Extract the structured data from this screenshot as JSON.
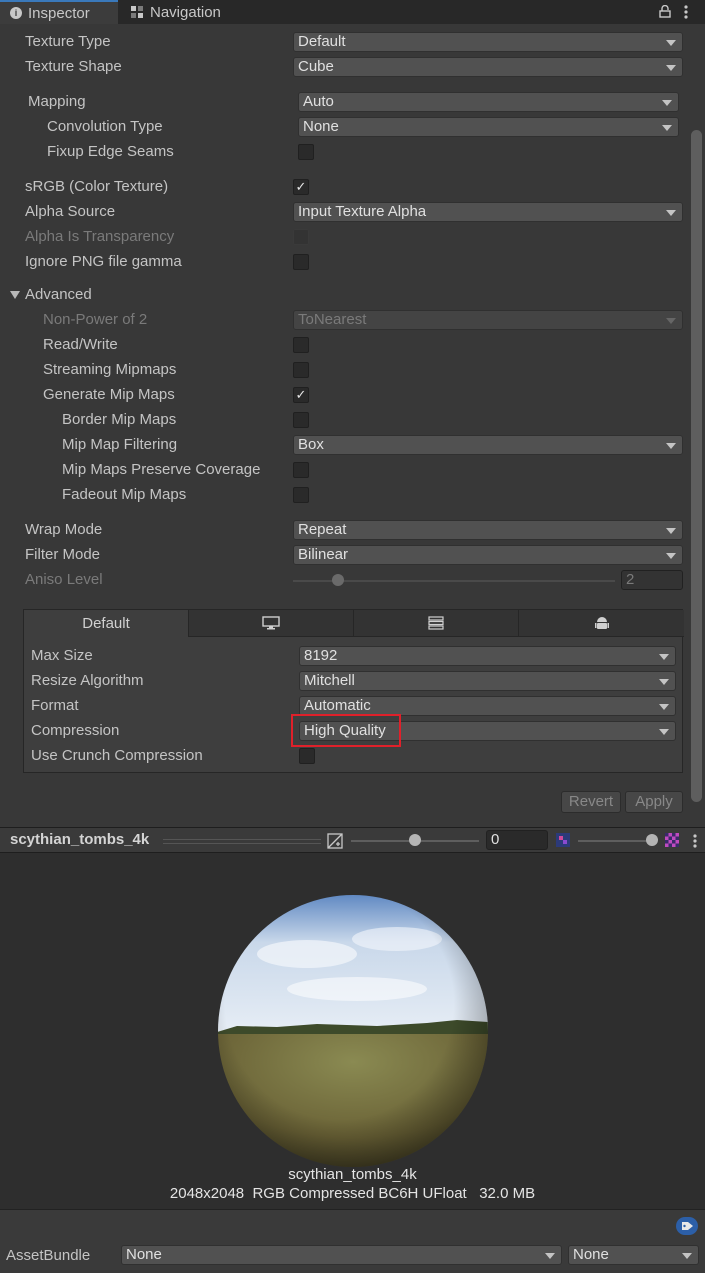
{
  "tabs": [
    {
      "label": "Inspector",
      "icon": "info-icon"
    },
    {
      "label": "Navigation",
      "icon": "navigation-icon"
    }
  ],
  "fields": {
    "texture_type": {
      "label": "Texture Type",
      "value": "Default"
    },
    "texture_shape": {
      "label": "Texture Shape",
      "value": "Cube"
    },
    "mapping": {
      "label": "Mapping",
      "value": "Auto"
    },
    "convolution_type": {
      "label": "Convolution Type",
      "value": "None"
    },
    "fixup_edge_seams": {
      "label": "Fixup Edge Seams",
      "checked": false
    },
    "srgb": {
      "label": "sRGB (Color Texture)",
      "checked": true
    },
    "alpha_source": {
      "label": "Alpha Source",
      "value": "Input Texture Alpha"
    },
    "alpha_is_transparency": {
      "label": "Alpha Is Transparency",
      "checked": false
    },
    "ignore_png_gamma": {
      "label": "Ignore PNG file gamma",
      "checked": false
    }
  },
  "advanced": {
    "label": "Advanced",
    "non_power_of_2": {
      "label": "Non-Power of 2",
      "value": "ToNearest"
    },
    "read_write": {
      "label": "Read/Write",
      "checked": false
    },
    "streaming_mipmaps": {
      "label": "Streaming Mipmaps",
      "checked": false
    },
    "generate_mip_maps": {
      "label": "Generate Mip Maps",
      "checked": true
    },
    "border_mip_maps": {
      "label": "Border Mip Maps",
      "checked": false
    },
    "mip_map_filtering": {
      "label": "Mip Map Filtering",
      "value": "Box"
    },
    "mip_maps_preserve_coverage": {
      "label": "Mip Maps Preserve Coverage",
      "checked": false
    },
    "fadeout_mip_maps": {
      "label": "Fadeout Mip Maps",
      "checked": false
    }
  },
  "wrap_mode": {
    "label": "Wrap Mode",
    "value": "Repeat"
  },
  "filter_mode": {
    "label": "Filter Mode",
    "value": "Bilinear"
  },
  "aniso_level": {
    "label": "Aniso Level",
    "value": "2"
  },
  "platform": {
    "tabs": [
      {
        "label": "Default"
      },
      {
        "icon": "monitor-icon"
      },
      {
        "icon": "server-icon"
      },
      {
        "icon": "android-icon"
      }
    ],
    "max_size": {
      "label": "Max Size",
      "value": "8192"
    },
    "resize_algorithm": {
      "label": "Resize Algorithm",
      "value": "Mitchell"
    },
    "format": {
      "label": "Format",
      "value": "Automatic"
    },
    "compression": {
      "label": "Compression",
      "value": "High Quality"
    },
    "crunch": {
      "label": "Use Crunch Compression",
      "checked": false
    }
  },
  "buttons": {
    "revert": "Revert",
    "apply": "Apply"
  },
  "preview": {
    "asset_name": "scythian_tombs_4k",
    "exposure_value": "0",
    "caption_name": "scythian_tombs_4k",
    "caption_info": "2048x2048  RGB Compressed BC6H UFloat   32.0 MB"
  },
  "assetbundle": {
    "label": "AssetBundle",
    "value": "None",
    "variant": "None"
  },
  "colors": {
    "accent": "#3a79bb",
    "highlight_box": "#e0202a"
  }
}
